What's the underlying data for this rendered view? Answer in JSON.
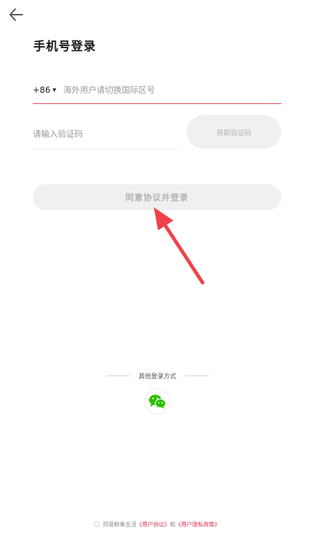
{
  "header": {
    "back_icon": "arrow-left-icon",
    "title": "手机号登录"
  },
  "phone": {
    "country_code": "+86",
    "placeholder": "海外用户请切换国际区号",
    "value": "",
    "underline_color": "#e8435a"
  },
  "code": {
    "placeholder": "请输入验证码",
    "value": "",
    "get_code_label": "获取验证码"
  },
  "login": {
    "label": "同意协议并登录"
  },
  "annotation": {
    "arrow_color": "#f0414a",
    "arrow_icon": "red-arrow-annotation"
  },
  "other_login": {
    "label": "其他登录方式",
    "wechat_icon": "wechat-icon",
    "wechat_color": "#2dc100"
  },
  "agreement": {
    "prefix": "同意粉象生活",
    "user_agreement": "《用户协议》",
    "and": "和",
    "privacy_policy": "《用户隐私政策》",
    "link_color": "#d8344f"
  }
}
